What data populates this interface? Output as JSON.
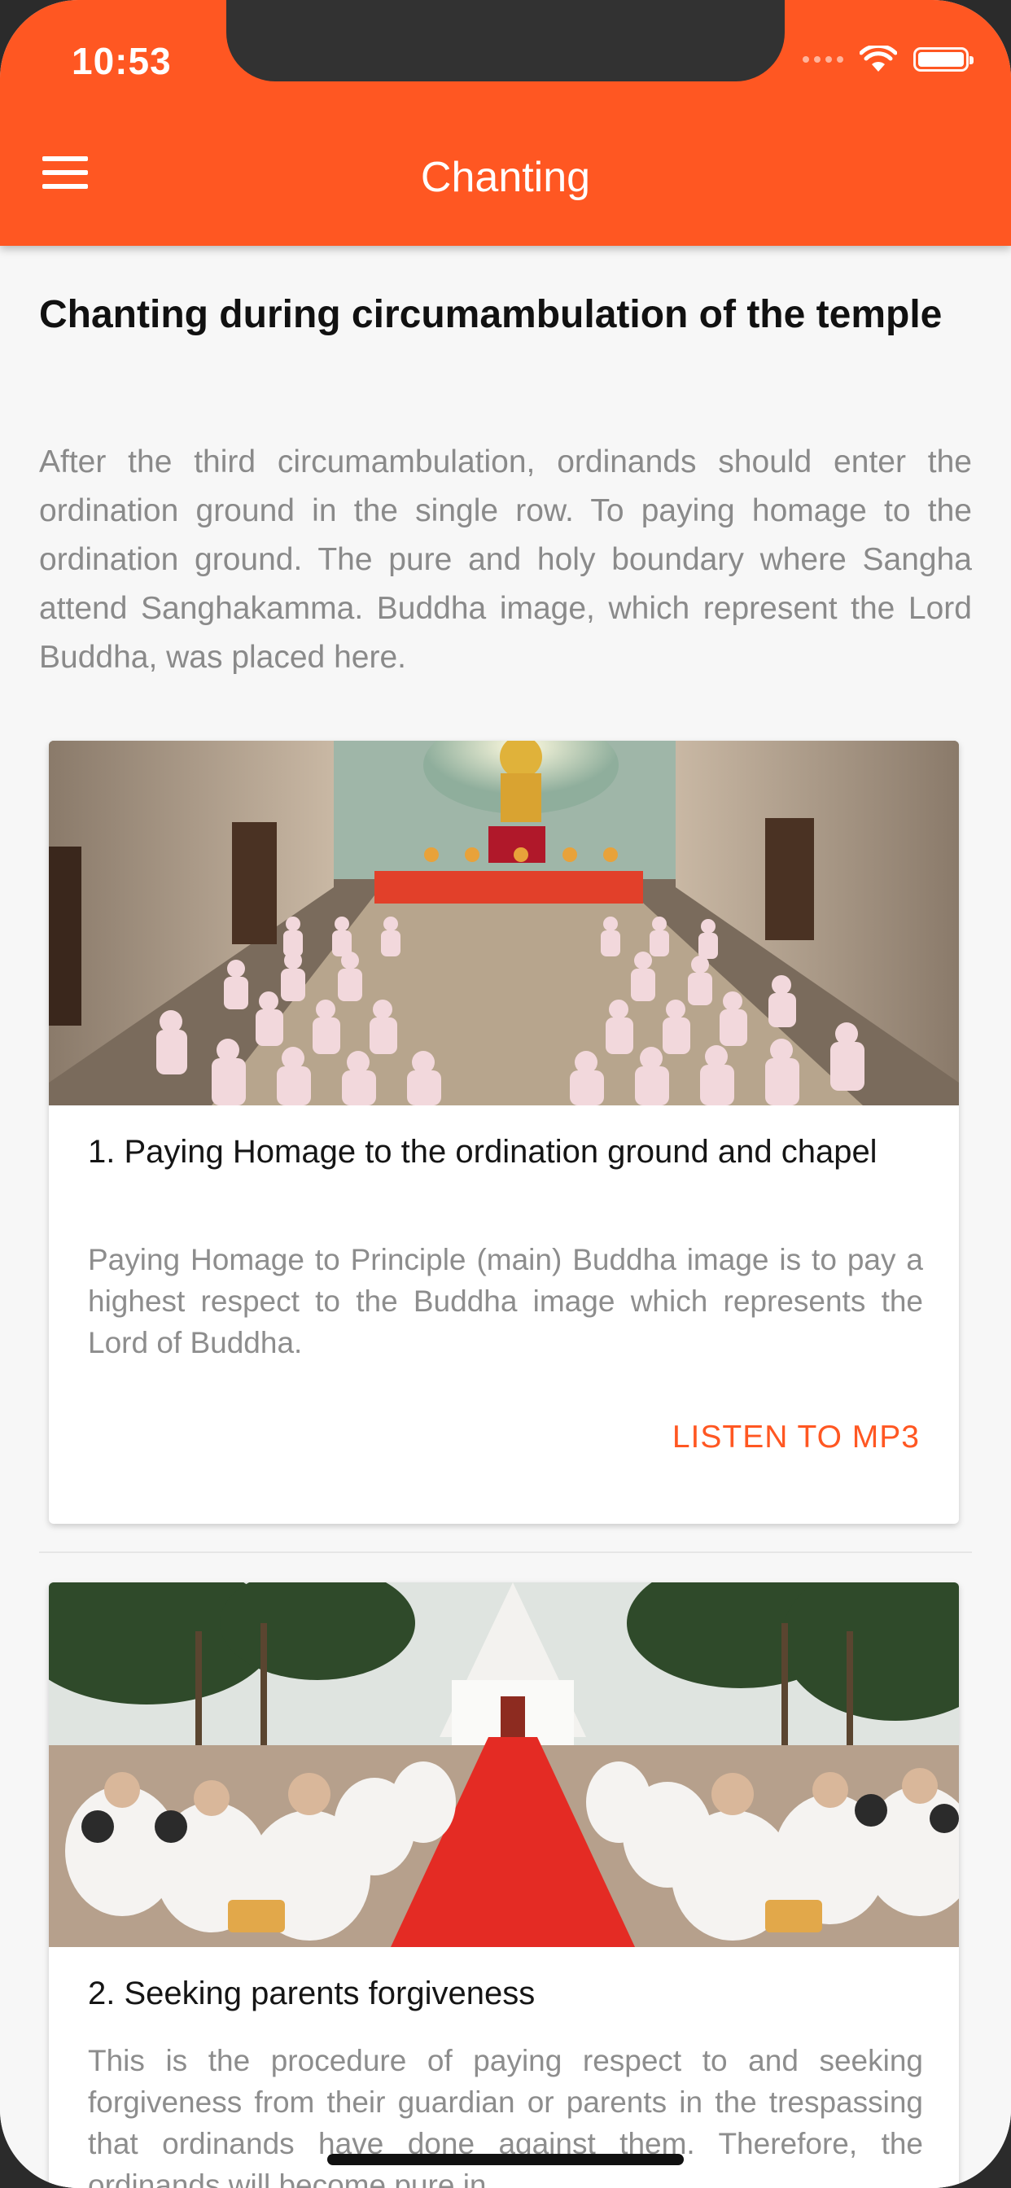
{
  "status_bar": {
    "time": "10:53"
  },
  "app_bar": {
    "title": "Chanting",
    "menu_icon": "hamburger-menu-icon",
    "background_color": "#ff5722"
  },
  "section": {
    "title": "Chanting during circumambulation of the temple",
    "description": "After the third circumambulation, ordinands should enter the ordination ground in the single row. To paying homage to the ordination ground. The pure and holy boundary where Sangha attend Sanghakamma. Buddha image, which represent the Lord Buddha, was placed here."
  },
  "cards": [
    {
      "image": "monks-in-ordination-hall-photo",
      "title": "1. Paying Homage to the ordination ground and chapel",
      "text": "Paying Homage to Principle (main) Buddha image is to pay a highest respect to the Buddha image which represents the Lord of Buddha.",
      "action_label": "LISTEN TO MP3"
    },
    {
      "image": "ordinands-seeking-forgiveness-outdoor-photo",
      "title": "2. Seeking parents forgiveness",
      "text": "This is the procedure of paying respect to and seeking forgiveness from their guardian or parents in the trespassing that ordinands have done against them. Therefore, the ordinands will become pure in"
    }
  ],
  "colors": {
    "accent": "#ff5722",
    "background": "#f7f7f7",
    "card": "#ffffff"
  }
}
